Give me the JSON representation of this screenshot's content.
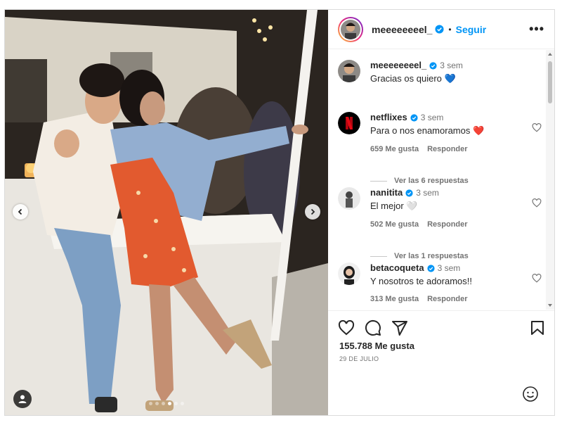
{
  "post": {
    "author": "meeeeeeeel_",
    "follow_label": "Seguir",
    "separator": "•",
    "more_label": "•••",
    "likes": "155.788 Me gusta",
    "date": "29 DE JULIO",
    "carousel_count": 6,
    "carousel_active_index": 3
  },
  "caption": {
    "username": "meeeeeeeel_",
    "time": "3 sem",
    "text": "Gracias os quiero 💙"
  },
  "comments": [
    {
      "username": "netflixes",
      "time": "3 sem",
      "text": "Para o nos enamoramos ❤️",
      "likes": "659 Me gusta",
      "reply_label": "Responder",
      "view_replies": "Ver las 6 respuestas"
    },
    {
      "username": "nanitita",
      "time": "3 sem",
      "text": "El mejor 🤍",
      "likes": "502 Me gusta",
      "reply_label": "Responder",
      "view_replies": "Ver las 1 respuestas"
    },
    {
      "username": "betacoqueta",
      "time": "3 sem",
      "text": "Y nosotros te adoramos!!",
      "likes": "313 Me gusta",
      "reply_label": "Responder",
      "view_replies": ""
    }
  ],
  "colors": {
    "accent": "#0095f6",
    "verified": "#0095f6",
    "netflix": "#e50914"
  }
}
